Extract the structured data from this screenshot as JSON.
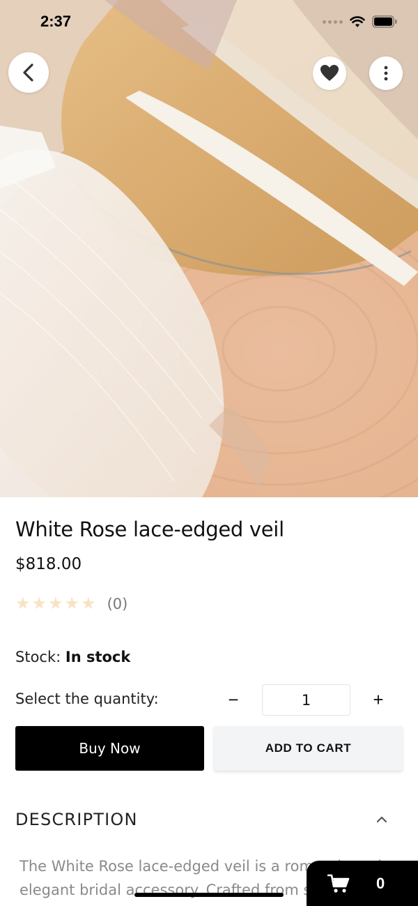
{
  "status_bar": {
    "time": "2:37"
  },
  "product": {
    "title": "White Rose lace-edged veil",
    "price": "$818.00",
    "rating": 0,
    "rating_count": "(0)",
    "stock_label": "Stock:",
    "stock_value": "In stock",
    "quantity_label": "Select the quantity:",
    "quantity": "1",
    "quantity_minus": "−",
    "quantity_plus": "+"
  },
  "actions": {
    "buy_now": "Buy Now",
    "add_to_cart": "ADD TO CART"
  },
  "description": {
    "title": "DESCRIPTION",
    "text": "The White Rose lace-edged veil is a romantic and elegant bridal accessory. Crafted from soft tulle"
  },
  "cart": {
    "count": "0"
  },
  "icons": {
    "back": "chevron-left-icon",
    "favorite": "heart-icon",
    "more": "more-vertical-icon",
    "cart": "cart-icon",
    "collapse": "chevron-up-icon"
  },
  "colors": {
    "primary_button": "#000000",
    "secondary_button": "#f3f4f6",
    "star_empty": "#f7e3c4"
  }
}
